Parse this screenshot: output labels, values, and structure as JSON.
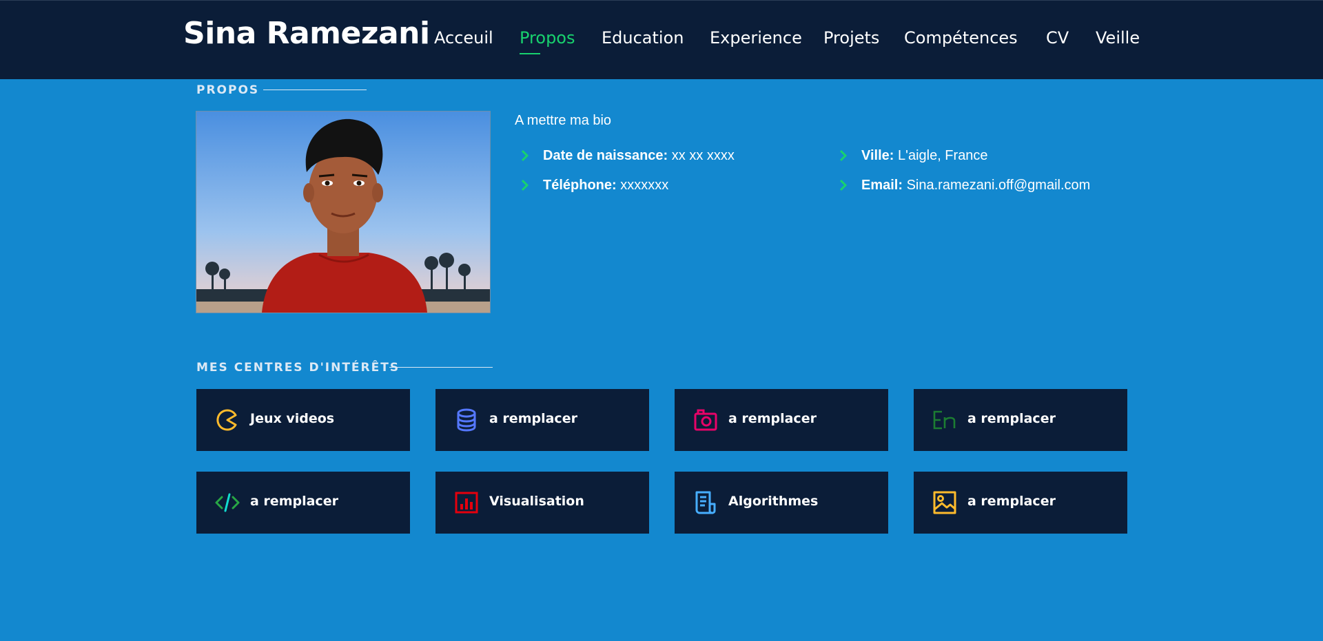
{
  "header": {
    "name": "Sina Ramezani",
    "nav": [
      {
        "label": "Acceuil",
        "active": false
      },
      {
        "label": "Propos",
        "active": true
      },
      {
        "label": "Education",
        "active": false
      },
      {
        "label": "Experience",
        "active": false
      },
      {
        "label": "Projets",
        "active": false
      },
      {
        "label": "Compétences",
        "active": false
      },
      {
        "label": "CV",
        "active": false
      },
      {
        "label": "Veille",
        "active": false
      }
    ]
  },
  "about": {
    "section_title": "PROPOS",
    "bio": "A mettre ma bio",
    "facts": [
      {
        "label": "Date de naissance:",
        "value": "xx xx xxxx"
      },
      {
        "label": "Ville:",
        "value": "L'aigle, France"
      },
      {
        "label": "Téléphone:",
        "value": "xxxxxxx"
      },
      {
        "label": "Email:",
        "value": "Sina.ramezani.off@gmail.com"
      }
    ]
  },
  "interests": {
    "section_title": "MES CENTRES D'INTÉRÊTS",
    "items": [
      {
        "label": "Jeux videos",
        "icon": "pacman-icon",
        "color": "#ffbb2c"
      },
      {
        "label": "a remplacer",
        "icon": "database-icon",
        "color": "#5578ff"
      },
      {
        "label": "a remplacer",
        "icon": "camera-icon",
        "color": "#e80368"
      },
      {
        "label": "a remplacer",
        "icon": "english-input-icon",
        "color": "#1c7d32"
      },
      {
        "label": "a remplacer",
        "icon": "code-icon",
        "color": "#11dbcf"
      },
      {
        "label": "Visualisation",
        "icon": "bar-chart-icon",
        "color": "#e5000d"
      },
      {
        "label": "Algorithmes",
        "icon": "document-icon",
        "color": "#47aeff"
      },
      {
        "label": "a remplacer",
        "icon": "image-icon",
        "color": "#ffbb2c"
      }
    ]
  },
  "colors": {
    "background": "#1388cf",
    "header_bg": "#0b1d38",
    "accent": "#18d26e"
  }
}
